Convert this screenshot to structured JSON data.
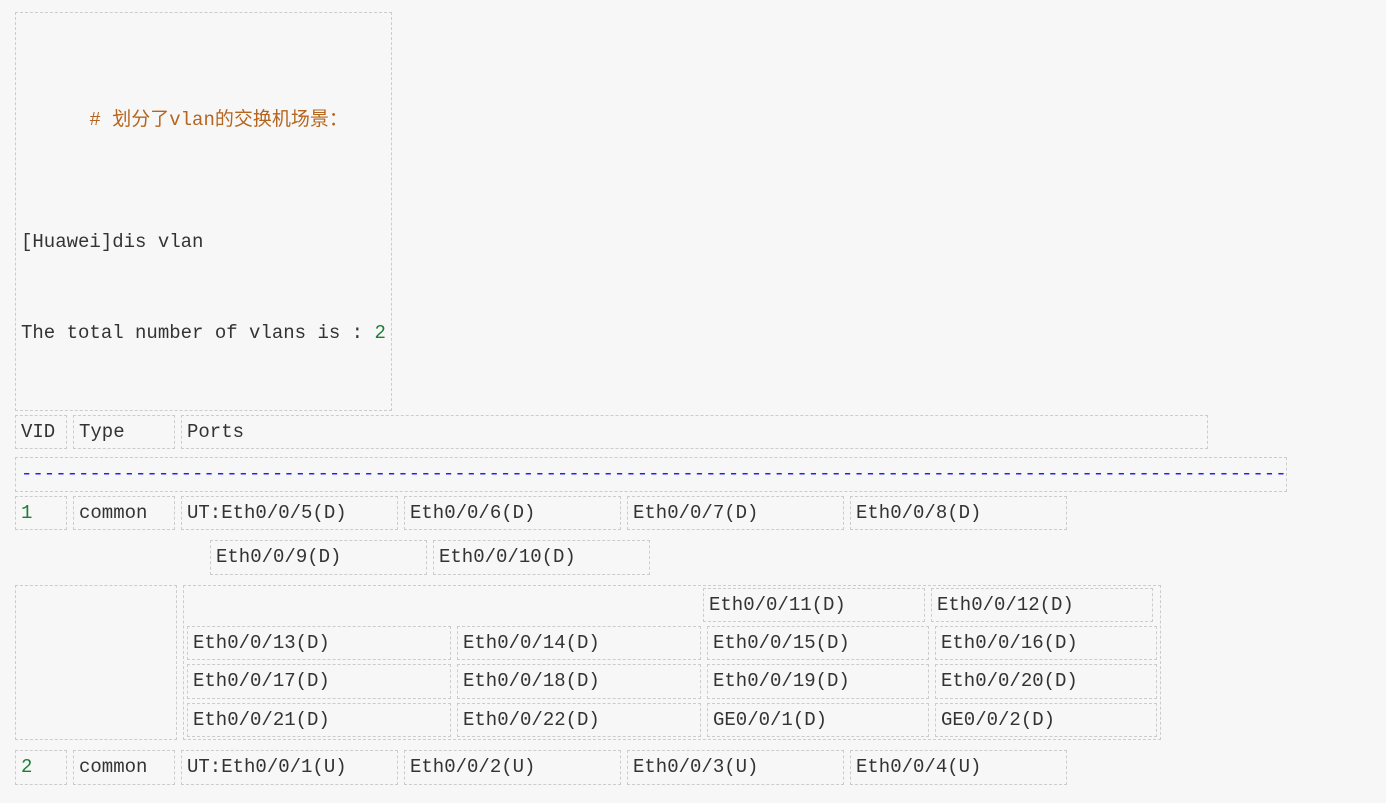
{
  "comment": {
    "hash": "# ",
    "text": "划分了vlan的交换机场景："
  },
  "cli": {
    "line1": "[Huawei]dis vlan",
    "line2_prefix": "The total number of vlans is : ",
    "line2_num": "2"
  },
  "header": {
    "vid": "VID",
    "type": "Type   ",
    "ports": "Ports"
  },
  "dashes": "--------------------------------------------------------------------------------------------------------------------------------",
  "vlan1": {
    "vid": "1",
    "type": "common",
    "row1": [
      "UT:Eth0/0/5(D)",
      "Eth0/0/6(D)",
      "Eth0/0/7(D)",
      "Eth0/0/8(D)"
    ],
    "row2": [
      "Eth0/0/9(D)",
      "Eth0/0/10(D)"
    ],
    "row2b": [
      "Eth0/0/11(D)",
      "Eth0/0/12(D)"
    ],
    "row3": [
      "Eth0/0/13(D)",
      "Eth0/0/14(D)",
      "Eth0/0/15(D)",
      "Eth0/0/16(D)"
    ],
    "row4": [
      "Eth0/0/17(D)",
      "Eth0/0/18(D)",
      "Eth0/0/19(D)",
      "Eth0/0/20(D)"
    ],
    "row5": [
      "Eth0/0/21(D)",
      "Eth0/0/22(D)",
      "GE0/0/1(D)",
      "GE0/0/2(D)"
    ]
  },
  "vlan2": {
    "vid": "2",
    "type": "common",
    "row1": [
      "UT:Eth0/0/1(U)",
      "Eth0/0/2(U)",
      "Eth0/0/3(U)",
      "Eth0/0/4(U)"
    ]
  }
}
